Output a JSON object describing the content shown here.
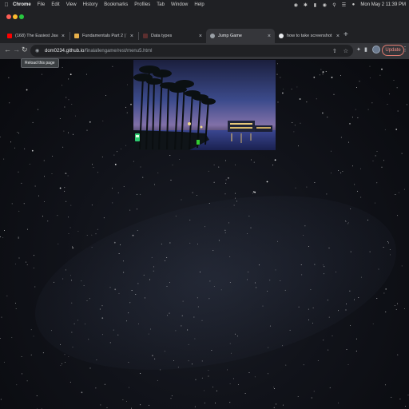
{
  "menubar": {
    "items": [
      "Chrome",
      "File",
      "Edit",
      "View",
      "History",
      "Bookmarks",
      "Profiles",
      "Tab",
      "Window",
      "Help"
    ],
    "datetime": "Mon May 2  11:39 PM"
  },
  "tabs": [
    {
      "title": "(168) The Easiest Javascript G",
      "favicon_color": "#ff0000",
      "active": false
    },
    {
      "title": "Fundamentals Part 2 | The Gri",
      "favicon_color": "#e8b04a",
      "active": false
    },
    {
      "title": "Data types",
      "favicon_color": "#5c2f2f",
      "active": false
    },
    {
      "title": "Jump Game",
      "favicon_color": "#9aa0a6",
      "active": true
    },
    {
      "title": "how to take screenshot mac",
      "favicon_color": "#e8eaed",
      "active": false
    }
  ],
  "address": {
    "host": "dom0234.github.io",
    "path": "/finalallengame/rest/menu5.html"
  },
  "toolbar": {
    "update_label": "Update",
    "reload_tooltip": "Reload this page"
  },
  "colors": {
    "accent_update": "#f28b82",
    "chrome_dark": "#202124",
    "toolbar": "#35363a"
  }
}
